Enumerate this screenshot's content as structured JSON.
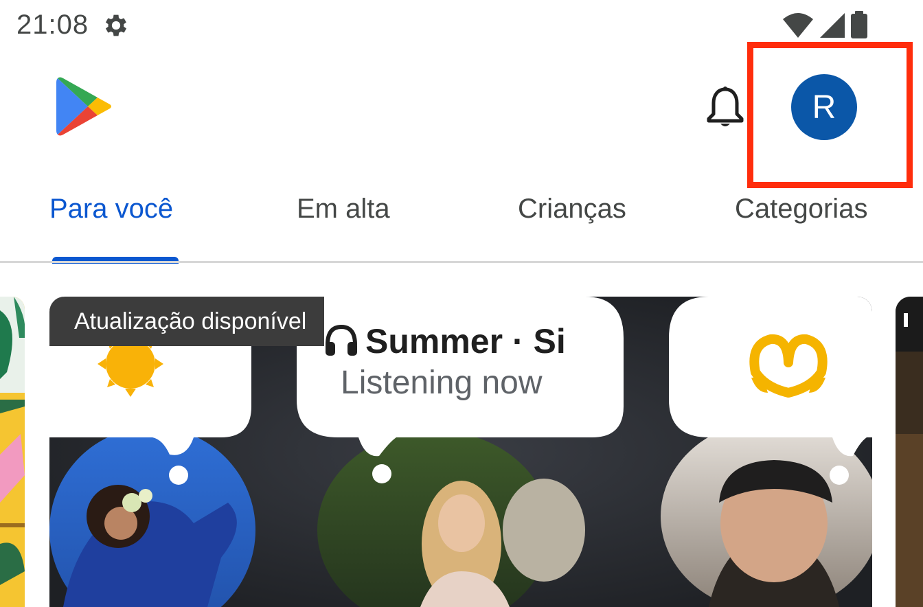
{
  "status_bar": {
    "time": "21:08",
    "icons": [
      "settings-gear-icon",
      "wifi-icon",
      "cellular-signal-icon",
      "battery-icon"
    ]
  },
  "header": {
    "logo": "google-play-logo",
    "notifications_icon": "bell-icon",
    "avatar_initial": "R",
    "avatar_color": "#0b57a8",
    "highlight_color": "#ff2d0c"
  },
  "tabs": [
    {
      "label": "Para você",
      "active": true
    },
    {
      "label": "Em alta",
      "active": false
    },
    {
      "label": "Crianças",
      "active": false
    },
    {
      "label": "Categorias",
      "active": false
    }
  ],
  "accent_color": "#0b57d0",
  "featured_card": {
    "badge": "Atualização disponível",
    "bubble_title": "Summer · Si",
    "bubble_subtitle": "Listening now",
    "bubble_emojis": [
      "sun-emoji",
      "heart-hands-emoji"
    ]
  }
}
